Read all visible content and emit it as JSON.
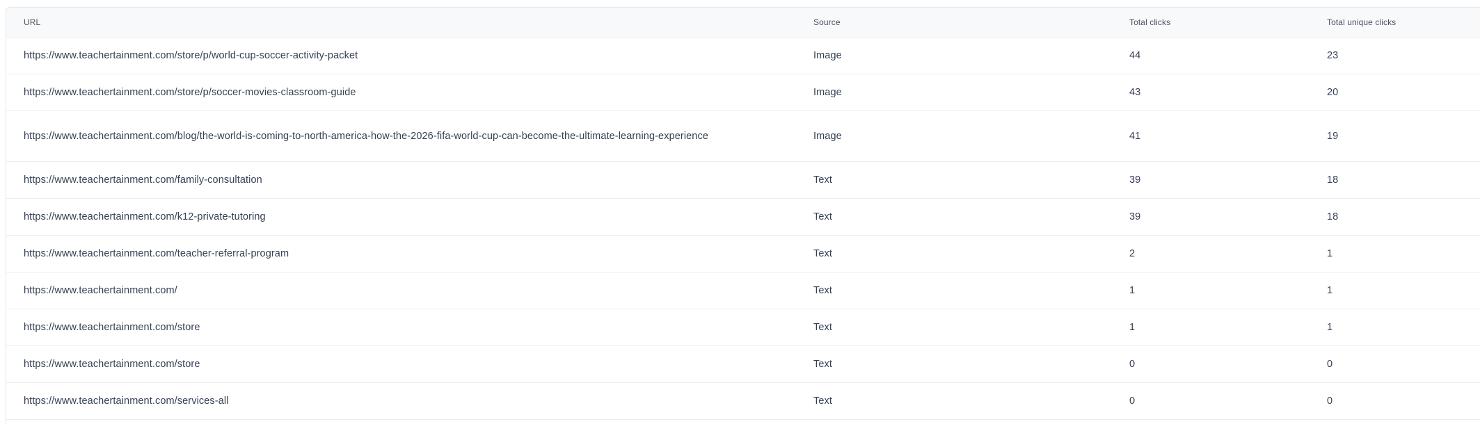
{
  "table": {
    "headers": {
      "url": "URL",
      "source": "Source",
      "total_clicks": "Total clicks",
      "total_unique_clicks": "Total unique clicks"
    },
    "rows": [
      {
        "url": "https://www.teachertainment.com/store/p/world-cup-soccer-activity-packet",
        "source": "Image",
        "total_clicks": "44",
        "total_unique_clicks": "23"
      },
      {
        "url": "https://www.teachertainment.com/store/p/soccer-movies-classroom-guide",
        "source": "Image",
        "total_clicks": "43",
        "total_unique_clicks": "20"
      },
      {
        "url": "https://www.teachertainment.com/blog/the-world-is-coming-to-north-america-how-the-2026-fifa-world-cup-can-become-the-ultimate-learning-experience",
        "source": "Image",
        "total_clicks": "41",
        "total_unique_clicks": "19"
      },
      {
        "url": "https://www.teachertainment.com/family-consultation",
        "source": "Text",
        "total_clicks": "39",
        "total_unique_clicks": "18"
      },
      {
        "url": "https://www.teachertainment.com/k12-private-tutoring",
        "source": "Text",
        "total_clicks": "39",
        "total_unique_clicks": "18"
      },
      {
        "url": "https://www.teachertainment.com/teacher-referral-program",
        "source": "Text",
        "total_clicks": "2",
        "total_unique_clicks": "1"
      },
      {
        "url": "https://www.teachertainment.com/",
        "source": "Text",
        "total_clicks": "1",
        "total_unique_clicks": "1"
      },
      {
        "url": "https://www.teachertainment.com/store",
        "source": "Text",
        "total_clicks": "1",
        "total_unique_clicks": "1"
      },
      {
        "url": "https://www.teachertainment.com/store",
        "source": "Text",
        "total_clicks": "0",
        "total_unique_clicks": "0"
      },
      {
        "url": "https://www.teachertainment.com/services-all",
        "source": "Text",
        "total_clicks": "0",
        "total_unique_clicks": "0"
      }
    ]
  }
}
